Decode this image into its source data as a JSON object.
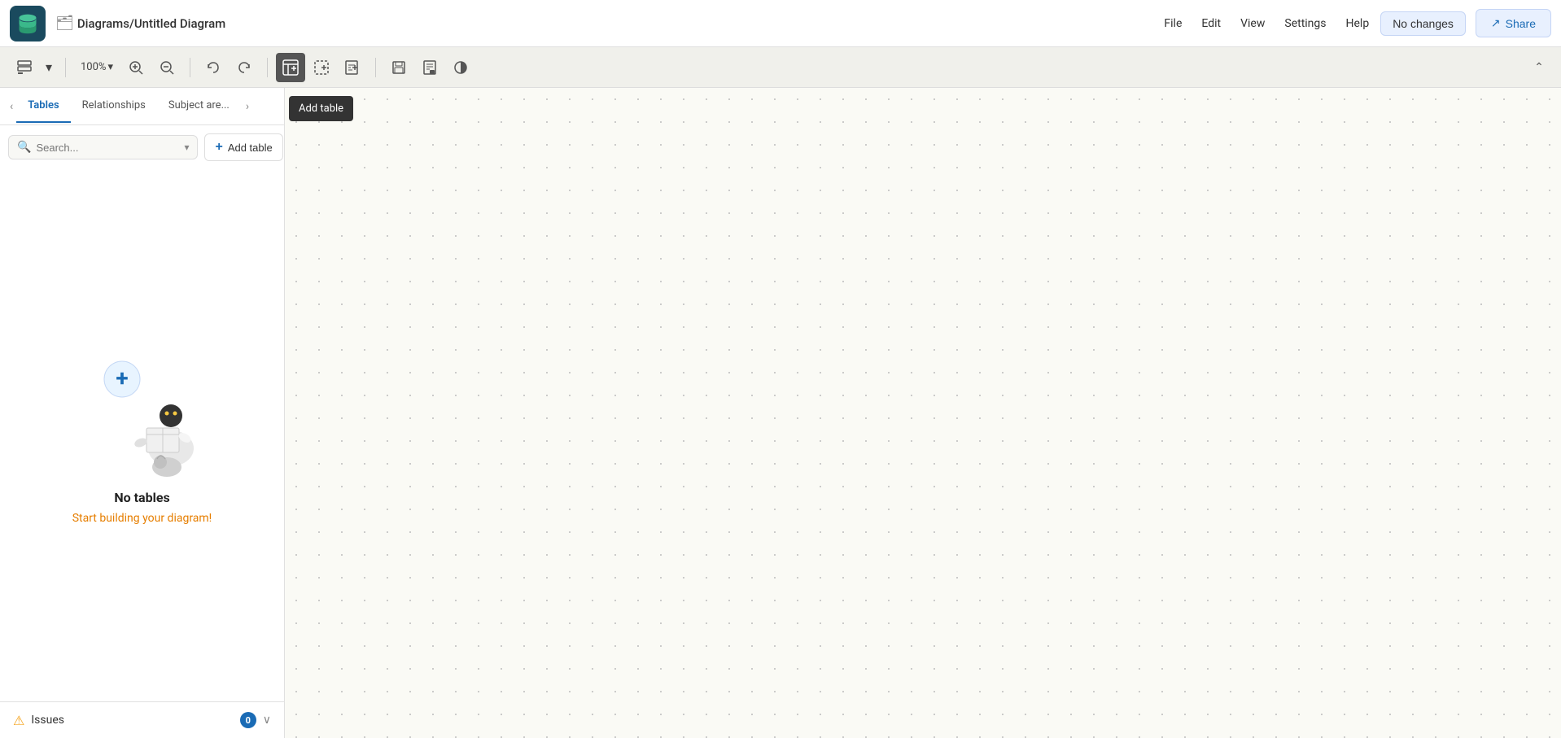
{
  "app": {
    "logo_alt": "DBngin logo"
  },
  "topbar": {
    "breadcrumb_icon": "🗂",
    "breadcrumb_text": "Diagrams/Untitled Diagram",
    "nav": [
      {
        "label": "File",
        "id": "file"
      },
      {
        "label": "Edit",
        "id": "edit"
      },
      {
        "label": "View",
        "id": "view"
      },
      {
        "label": "Settings",
        "id": "settings"
      },
      {
        "label": "Help",
        "id": "help"
      }
    ],
    "no_changes_label": "No changes",
    "share_label": "Share",
    "share_icon": "↗"
  },
  "toolbar": {
    "zoom_value": "100%",
    "zoom_chevron": "▾",
    "zoom_in_icon": "+",
    "zoom_out_icon": "−",
    "undo_icon": "↩",
    "redo_icon": "↪",
    "add_table_icon": "⊞",
    "add_subject_icon": "⊡",
    "add_note_icon": "⊕",
    "save_icon": "💾",
    "calendar_icon": "📅",
    "contrast_icon": "◑",
    "collapse_icon": "⌃",
    "tooltip_text": "Add table"
  },
  "sidebar": {
    "tabs": [
      {
        "label": "Tables",
        "active": true
      },
      {
        "label": "Relationships",
        "active": false
      },
      {
        "label": "Subject are...",
        "active": false
      }
    ],
    "search_placeholder": "Search...",
    "add_table_label": "Add table",
    "empty_title": "No tables",
    "empty_subtitle": "Start building your diagram!",
    "issues": {
      "label": "Issues",
      "count": "0"
    }
  }
}
